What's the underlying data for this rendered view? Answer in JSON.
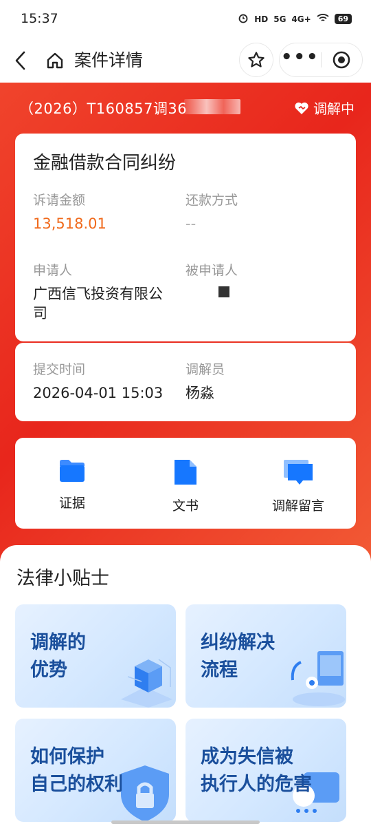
{
  "status_bar": {
    "time": "15:37",
    "hd_label": "HD",
    "signal_5g": "5G",
    "signal_4g": "4G+",
    "battery": "69"
  },
  "nav": {
    "title": "案件详情"
  },
  "case": {
    "number": "（2026）T160857调36",
    "status": "调解中",
    "type": "金融借款合同纠纷",
    "amount_label": "诉请金额",
    "amount": "13,518.01",
    "repayment_label": "还款方式",
    "repayment": "--",
    "applicant_label": "申请人",
    "applicant_line1": "广西信飞投资有限公",
    "applicant_line2": "司",
    "respondent_label": "被申请人",
    "submit_label": "提交时间",
    "submit_time": "2026-04-01 15:03",
    "mediator_label": "调解员",
    "mediator": "杨淼"
  },
  "tools": [
    {
      "label": "证据",
      "icon": "folder-icon"
    },
    {
      "label": "文书",
      "icon": "document-icon"
    },
    {
      "label": "调解留言",
      "icon": "message-icon"
    }
  ],
  "tips": {
    "title": "法律小贴士",
    "items": [
      {
        "line1": "调解的",
        "line2": "优势"
      },
      {
        "line1": "纠纷解决",
        "line2": "流程"
      },
      {
        "line1": "如何保护",
        "line2": "自己的权利"
      },
      {
        "line1": "成为失信被",
        "line2": "执行人的危害"
      }
    ]
  },
  "colors": {
    "hero": "#e8261c",
    "amount": "#f06a1c",
    "icon_blue": "#1677ff",
    "tip_text": "#1a4f9c"
  }
}
